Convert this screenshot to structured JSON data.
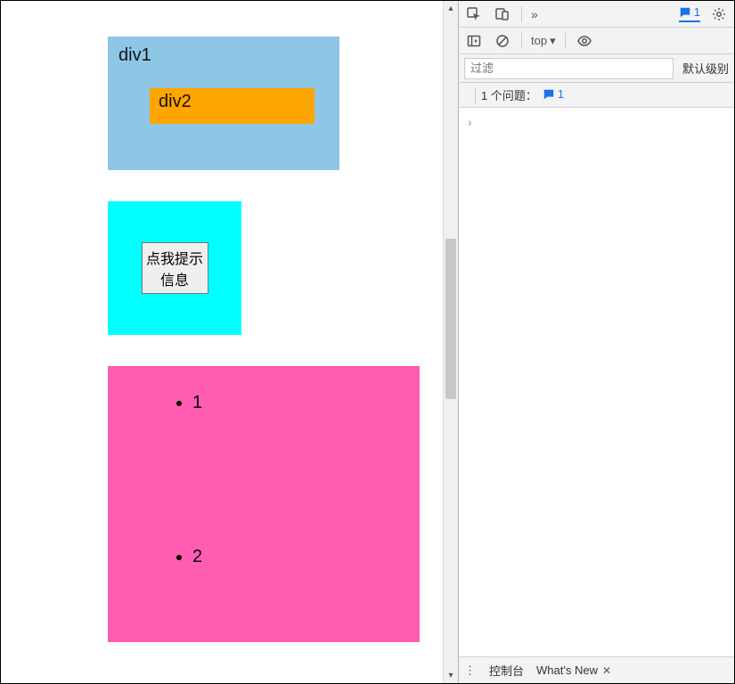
{
  "page": {
    "div1_label": "div1",
    "div2_label": "div2",
    "button_label": "点我提示信息",
    "list_items": [
      "1",
      "2"
    ]
  },
  "devtools": {
    "messages_count": "1",
    "context_dropdown": "top",
    "filter_placeholder": "过滤",
    "levels_label": "默认级别",
    "issues_label": "1 个问题：",
    "issues_count": "1",
    "prompt": "›",
    "bottom_tabs": {
      "console": "控制台",
      "whatsnew": "What's New"
    }
  }
}
